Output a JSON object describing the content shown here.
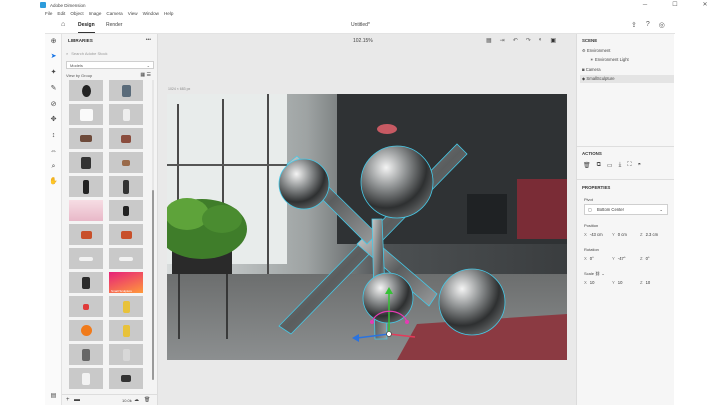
{
  "app": {
    "title": "Adobe Dimension"
  },
  "window_controls": {
    "minimize": "─",
    "maximize": "☐",
    "close": "✕"
  },
  "menu": [
    "File",
    "Edit",
    "Object",
    "Image",
    "Camera",
    "View",
    "Window",
    "Help"
  ],
  "tabs": {
    "design": "Design",
    "render": "Render"
  },
  "document": {
    "title": "Untitled*"
  },
  "top_icons": {
    "share": "⇪",
    "help": "?",
    "settings": "◎"
  },
  "tools": [
    {
      "name": "add-icon",
      "glyph": "⊕"
    },
    {
      "name": "select-icon",
      "glyph": "➤"
    },
    {
      "name": "magic-wand-icon",
      "glyph": "✦"
    },
    {
      "name": "paint-icon",
      "glyph": "✎"
    },
    {
      "name": "sample-icon",
      "glyph": "⊘"
    },
    {
      "name": "orbit-icon",
      "glyph": "✥"
    },
    {
      "name": "dolly-icon",
      "glyph": "↕"
    },
    {
      "name": "pan-icon",
      "glyph": "⇔"
    },
    {
      "name": "zoom-icon",
      "glyph": "⌕"
    },
    {
      "name": "hand-icon",
      "glyph": "✋"
    }
  ],
  "libraries": {
    "title": "LIBRARIES",
    "more": "•••",
    "search_placeholder": "Search Adobe Stock",
    "filter": "Models",
    "view_by": "View by Group",
    "footer_size": "10.0k"
  },
  "thumbnail_label": "Small Sculpture",
  "canvas": {
    "zoom": "102.15%",
    "dims": "1024 × 683 px"
  },
  "scene": {
    "title": "SCENE",
    "items": [
      "Environment",
      "Environment Light",
      "Camera",
      "SmallSculpture"
    ]
  },
  "actions": {
    "title": "ACTIONS"
  },
  "properties": {
    "title": "PROPERTIES",
    "pivot_label": "Pivot",
    "pivot_value": "Bottom Center",
    "position_label": "Position",
    "position": {
      "x": "-43 cm",
      "y": "0 cm",
      "z": "2.3 cm"
    },
    "rotation_label": "Rotation",
    "rotation": {
      "x": "0°",
      "y": "-47°",
      "z": "0°"
    },
    "scale_label": "Scale",
    "scale": {
      "x": "10",
      "y": "10",
      "z": "10"
    }
  },
  "colors": {
    "accent": "#1473e6",
    "selection": "#46c8e6"
  }
}
